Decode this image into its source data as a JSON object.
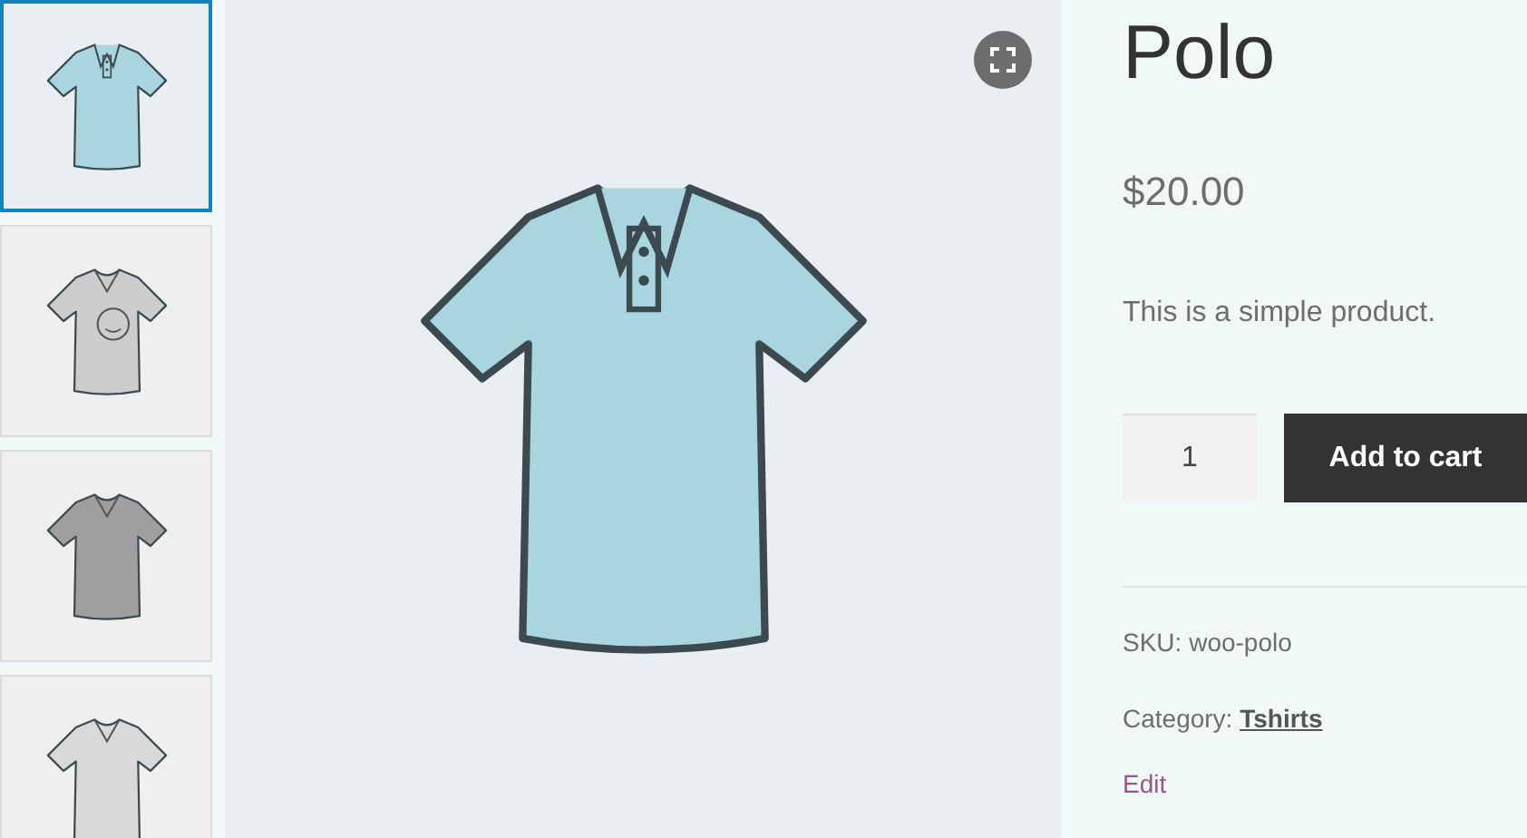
{
  "thumbnails": [
    {
      "kind": "polo",
      "color": "#a9d5df",
      "selected": true
    },
    {
      "kind": "emoji-tee",
      "color": "#cdcdcd",
      "selected": false
    },
    {
      "kind": "vneck",
      "color": "#9f9f9f",
      "selected": false
    },
    {
      "kind": "vneck",
      "color": "#d9d9d9",
      "selected": false
    }
  ],
  "product": {
    "title": "Polo",
    "price": "$20.00",
    "description": "This is a simple product.",
    "quantity": "1",
    "add_to_cart": "Add to cart",
    "sku_label": "SKU:",
    "sku": "woo-polo",
    "category_label": "Category:",
    "category": "Tshirts",
    "edit": "Edit"
  }
}
